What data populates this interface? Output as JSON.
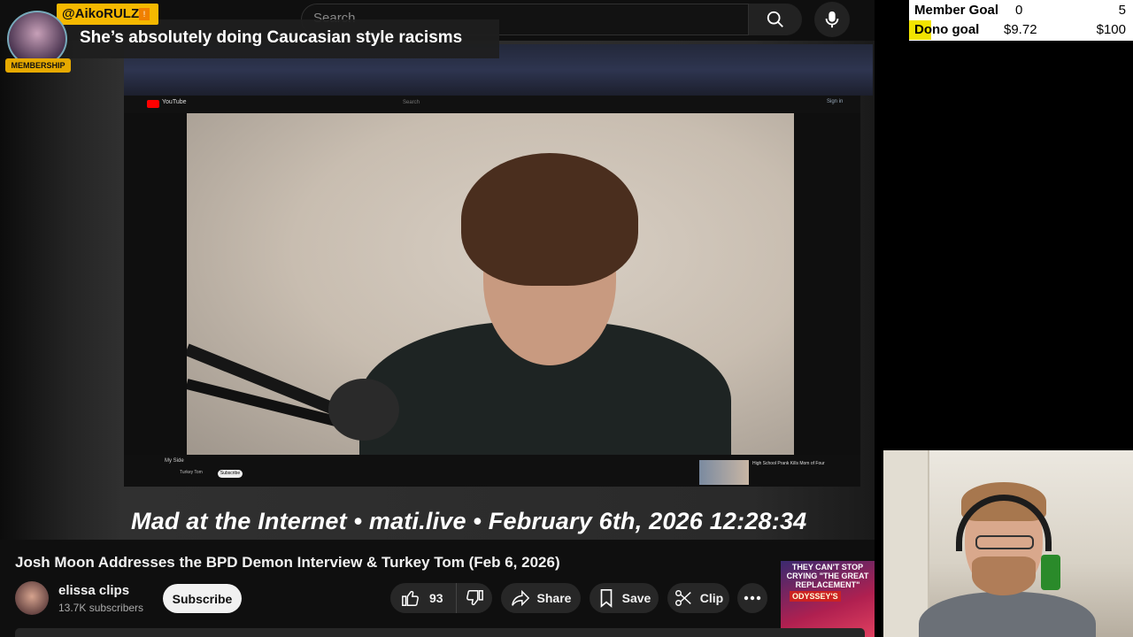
{
  "search": {
    "placeholder": "Search"
  },
  "chat": {
    "username": "@AikoRULZ",
    "message": "She’s absolutely doing Caucasian style racisms",
    "badge": "MEMBERSHIP"
  },
  "player": {
    "watermark": "Mad at the Internet • mati.live • February 6th, 2026 12:28:34",
    "inner": {
      "title": "My Side",
      "channel": "Turkey Tom",
      "subscribe": "Subscribe",
      "signin": "Sign in",
      "search": "Search",
      "logo": "YouTube",
      "rec_title": "High School Prank Kills Mom of Four"
    }
  },
  "video": {
    "title": "Josh Moon Addresses the BPD Demon Interview & Turkey Tom (Feb 6, 2026)",
    "channel_name": "elissa clips",
    "subscribers": "13.7K subscribers",
    "subscribe_label": "Subscribe",
    "likes": "93",
    "share_label": "Share",
    "save_label": "Save",
    "clip_label": "Clip"
  },
  "ad": {
    "headline": "THEY CAN'T STOP CRYING \"THE GREAT REPLACEMENT\"",
    "tag": "ODYSSEY'S"
  },
  "goals": {
    "member": {
      "label": "Member Goal",
      "current": "0",
      "target": "5"
    },
    "dono": {
      "label": "Dono goal",
      "current": "$9.72",
      "target": "$100",
      "progress": 0.0972
    }
  },
  "colors": {
    "membership_gold": "#f5b800",
    "dono_fill": "#f2e400",
    "youtube_red": "#ff0000"
  }
}
